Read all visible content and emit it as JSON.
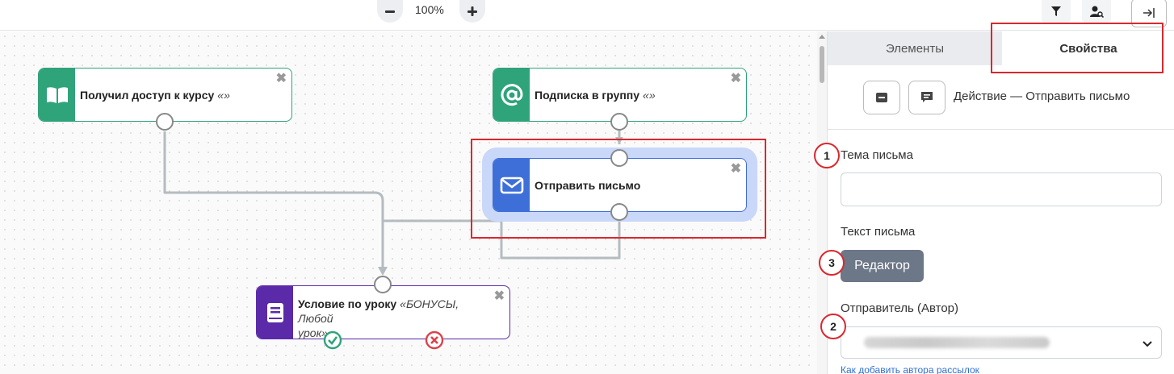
{
  "toolbar": {
    "zoom_level": "100%",
    "zoom_out_icon": "minus-icon",
    "zoom_in_icon": "plus-icon",
    "filter_icon": "filter-icon",
    "user_search_icon": "user-search-icon",
    "collapse_icon": "collapse-right-icon"
  },
  "nodes": {
    "course_access": {
      "title": "Получил доступ к курсу",
      "param": "«»",
      "icon": "book-open-icon",
      "color": "#2fa37a"
    },
    "group_subscription": {
      "title": "Подписка в группу",
      "param": "«»",
      "icon": "at-sign-icon",
      "color": "#2fa37a"
    },
    "send_email": {
      "title": "Отправить письмо",
      "icon": "envelope-icon",
      "color": "#3e6fd8"
    },
    "lesson_condition": {
      "title": "Условие по уроку",
      "param_line1": "«БОНУСЫ, Любой",
      "param_line2": "урок»",
      "icon": "book-icon",
      "color": "#5b2aa8"
    },
    "close_glyph": "✖"
  },
  "panel": {
    "tabs": [
      {
        "label": "Элементы",
        "active": false
      },
      {
        "label": "Свойства",
        "active": true
      }
    ],
    "action_title": "Действие — Отправить письмо",
    "subject_label": "Тема письма",
    "subject_value": "",
    "body_label": "Текст письма",
    "editor_button": "Редактор",
    "sender_label": "Отправитель (Автор)",
    "help_link": "Как добавить автора рассылок"
  },
  "annotations": {
    "badge_1": "1",
    "badge_2": "2",
    "badge_3": "3",
    "color": "#d9282f"
  }
}
